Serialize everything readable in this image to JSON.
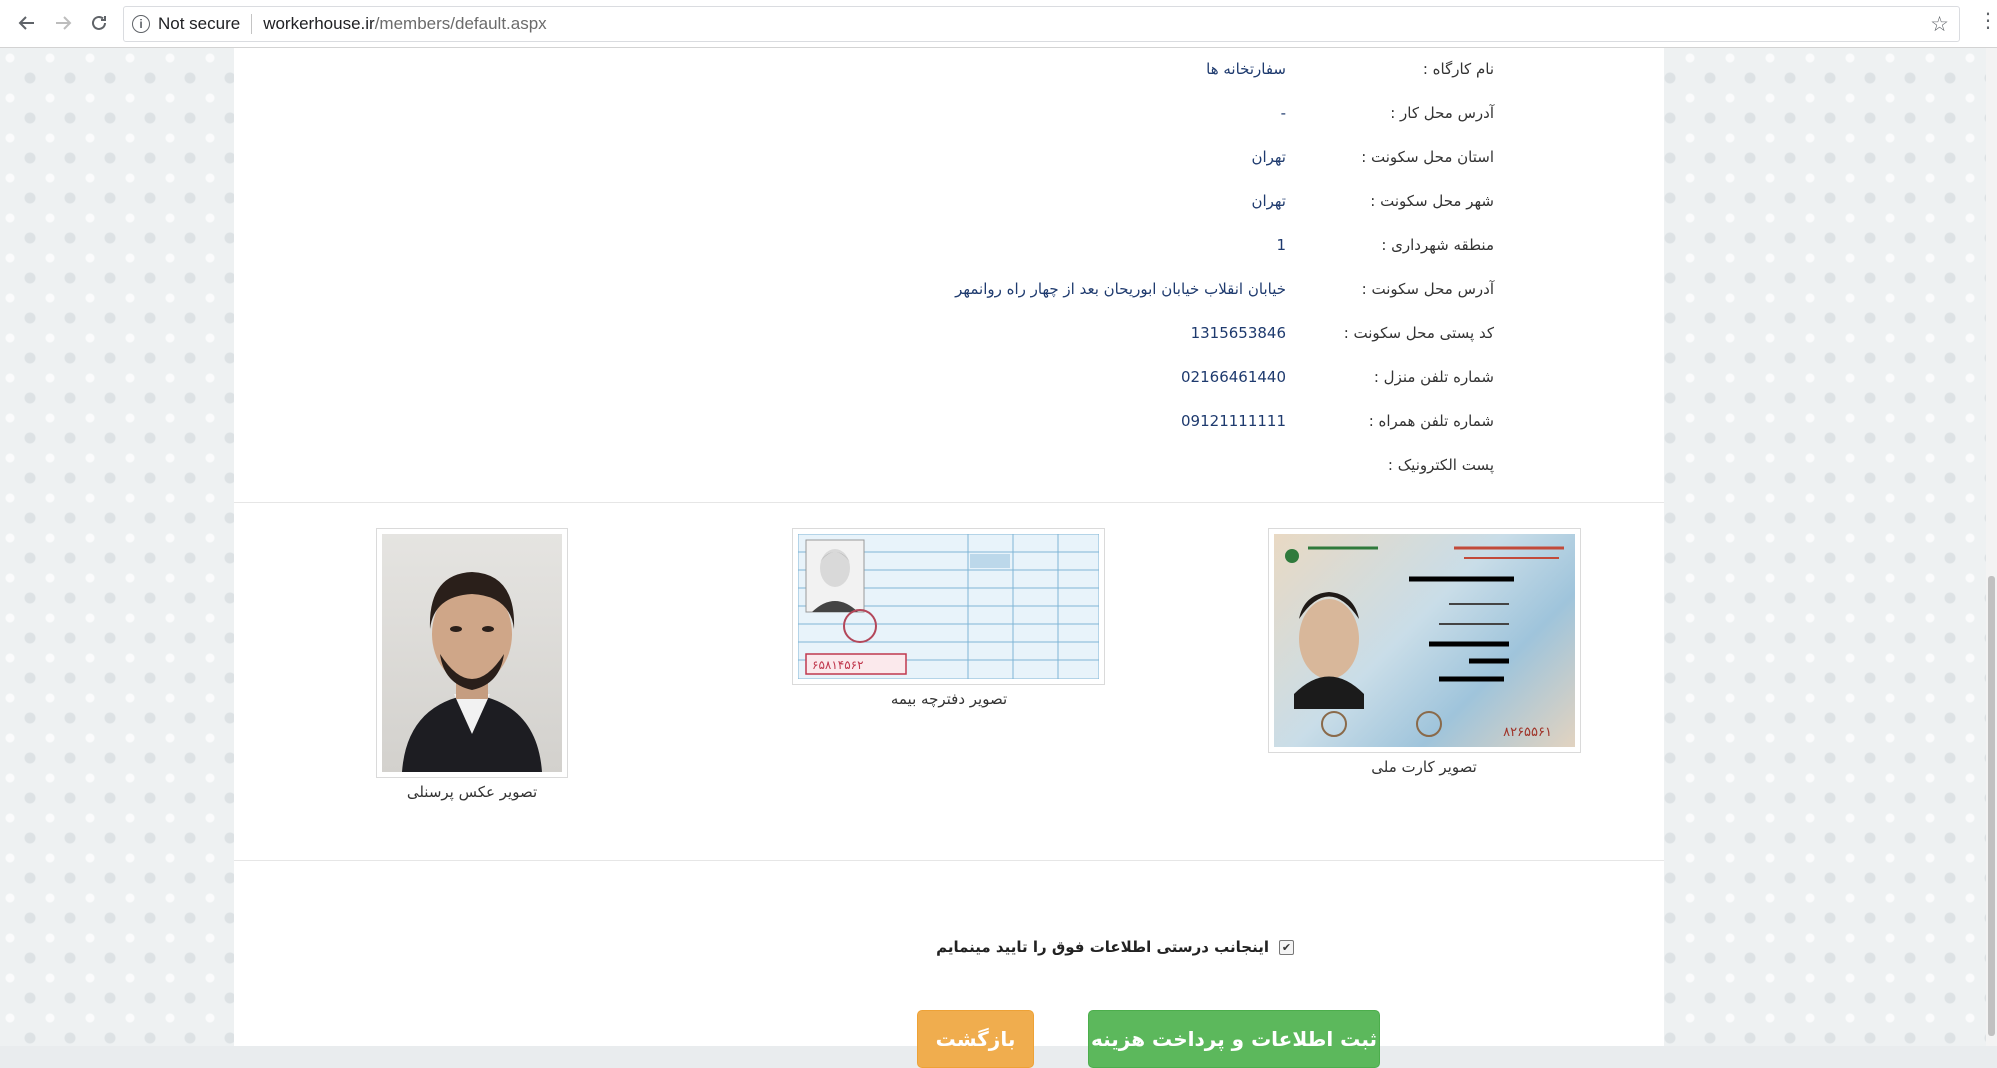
{
  "browser": {
    "security_label": "Not secure",
    "url_host": "workerhouse.ir",
    "url_path": "/members/default.aspx"
  },
  "profile": {
    "rows": [
      {
        "label": "نام کارگاه :",
        "value": "سفارتخانه ها"
      },
      {
        "label": "آدرس محل کار :",
        "value": "-"
      },
      {
        "label": "استان محل سکونت :",
        "value": "تهران"
      },
      {
        "label": "شهر محل سکونت :",
        "value": "تهران"
      },
      {
        "label": "منطقه شهرداری :",
        "value": "1"
      },
      {
        "label": "آدرس محل سکونت :",
        "value": "خیابان انقلاب خیابان ابوریحان بعد از چهار راه روانمهر"
      },
      {
        "label": "کد پستی محل سکونت :",
        "value": "1315653846"
      },
      {
        "label": "شماره تلفن منزل :",
        "value": "02166461440"
      },
      {
        "label": "شماره تلفن همراه :",
        "value": "09121111111"
      },
      {
        "label": "پست الکترونیک :",
        "value": ""
      }
    ]
  },
  "documents": {
    "national_card_caption": "تصویر کارت ملی",
    "insurance_caption": "تصویر دفترچه بیمه",
    "photo_caption": "تصویر عکس پرسنلی",
    "insurance_stamp_number": "۶۵۸۱۴۵۶۲",
    "national_card_number": "۸۲۶۵۵۶۱"
  },
  "confirmation": {
    "label": "اینجانب درستی اطلاعات فوق را تایید مینمایم",
    "checked": true
  },
  "actions": {
    "submit_label": "ثبت اطلاعات و پرداخت هزینه",
    "back_label": "بازگشت"
  },
  "colors": {
    "submit": "#5cb85c",
    "back": "#f0ad4e",
    "value_text": "#1e3a6e"
  }
}
